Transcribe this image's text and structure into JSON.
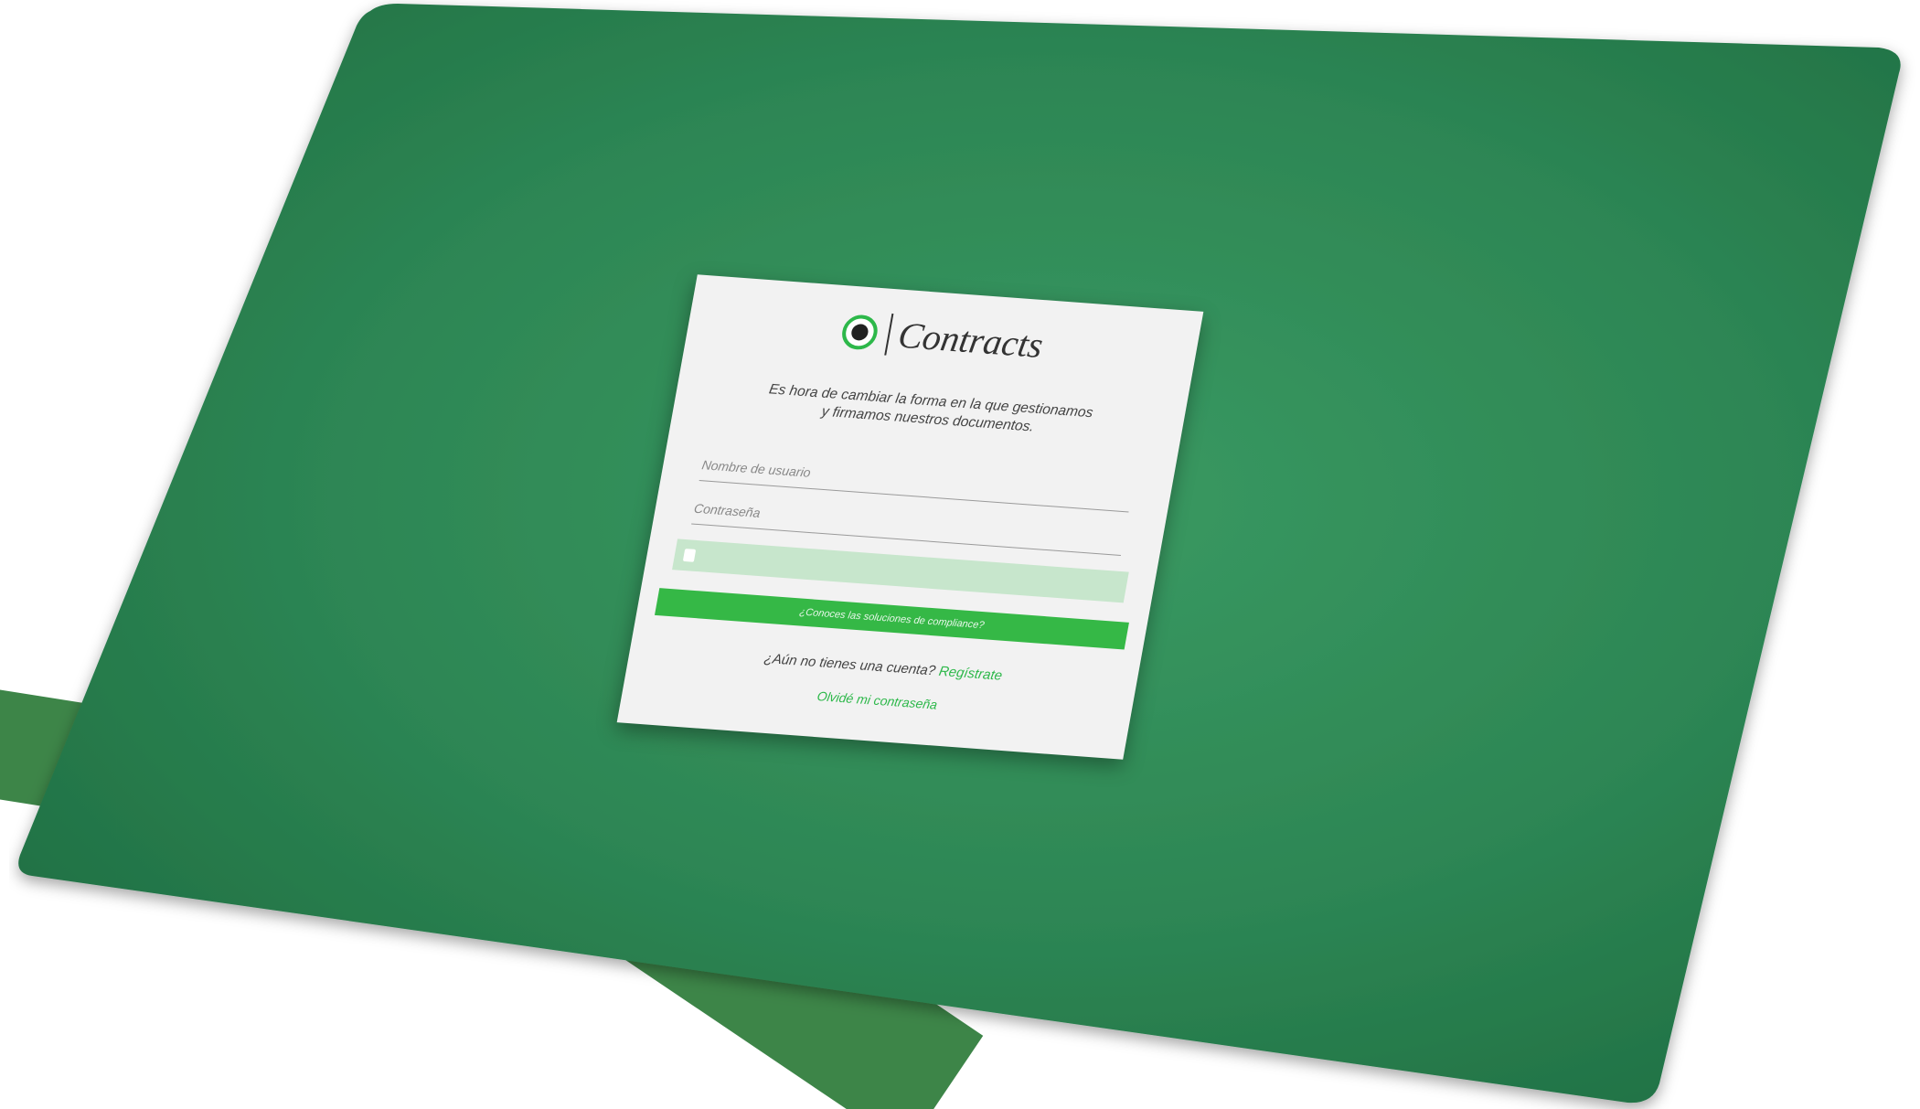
{
  "brand": {
    "logo_icon": "contracts-logo-icon",
    "name": "Contracts",
    "accent_color": "#2db84a",
    "board_color": "#2e8a55"
  },
  "login": {
    "tagline_line1": "Es hora de cambiar la forma en la que gestionamos",
    "tagline_line2": "y firmamos nuestros documentos.",
    "username_placeholder": "Nombre de usuario",
    "password_placeholder": "Contraseña",
    "login_button_label": "",
    "certificate_button_label": "¿Conoces las soluciones de compliance?",
    "signup_prompt": "¿Aún no tienes una cuenta?",
    "signup_link": "Regístrate",
    "forgot_password_link": "Olvidé mi contraseña"
  }
}
